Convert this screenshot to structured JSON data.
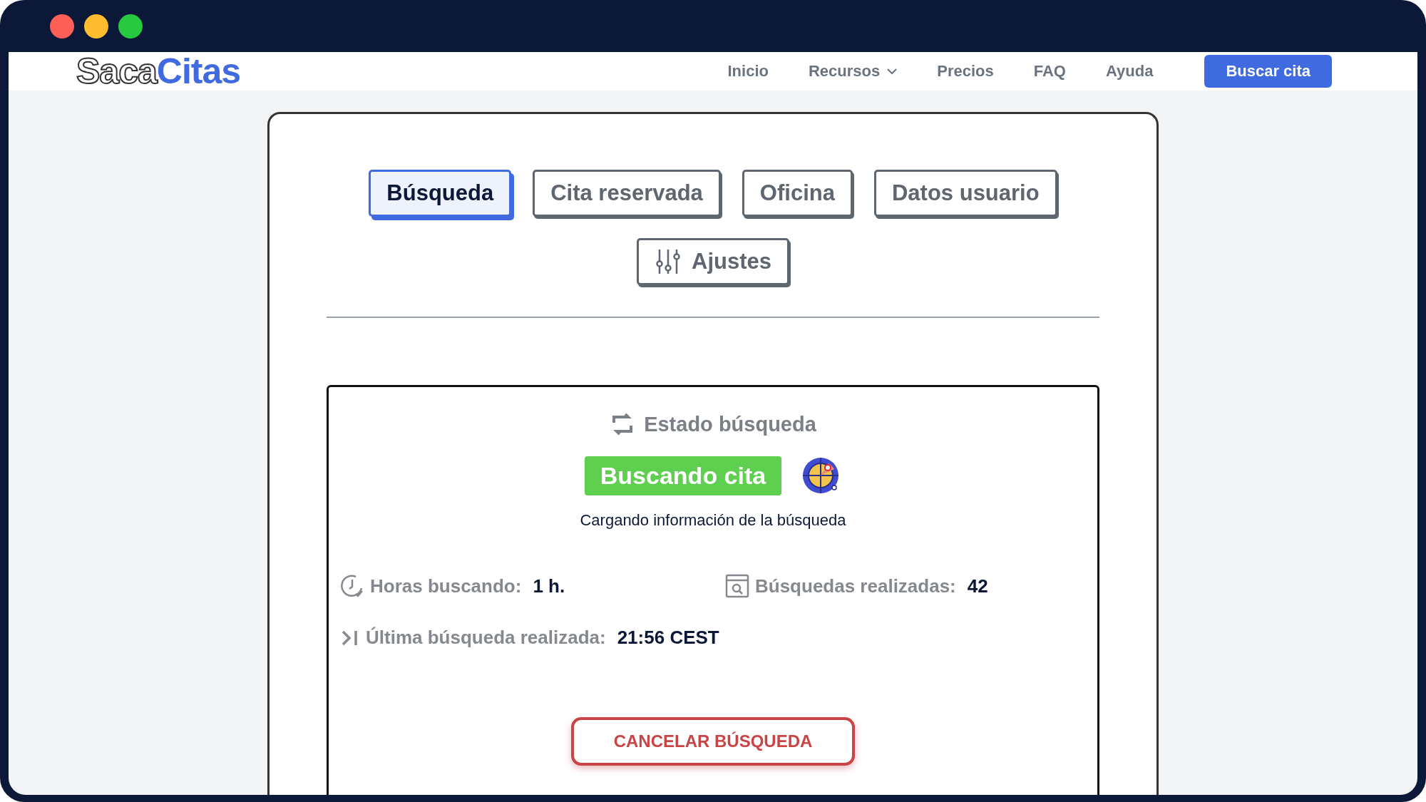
{
  "window": {
    "controls": [
      {
        "kind": "close"
      },
      {
        "kind": "minimize"
      },
      {
        "kind": "maximize"
      }
    ]
  },
  "header": {
    "logo": {
      "part_1": "Saca",
      "part_2": "Citas"
    },
    "nav": [
      {
        "label": "Inicio",
        "dropdown": false
      },
      {
        "label": "Recursos",
        "dropdown": true
      },
      {
        "label": "Precios",
        "dropdown": false
      },
      {
        "label": "FAQ",
        "dropdown": false
      },
      {
        "label": "Ayuda",
        "dropdown": false
      }
    ],
    "cta": "Buscar cita"
  },
  "tabs": [
    {
      "label": "Búsqueda",
      "selected": true,
      "icon": false
    },
    {
      "label": "Cita reservada",
      "selected": false,
      "icon": false
    },
    {
      "label": "Oficina",
      "selected": false,
      "icon": false
    },
    {
      "label": "Datos usuario",
      "selected": false,
      "icon": false
    },
    {
      "label": "Ajustes",
      "selected": false,
      "icon": true
    }
  ],
  "status": {
    "title": "Estado búsqueda",
    "badge": "Buscando cita",
    "message": "Cargando información de la búsqueda",
    "stats": [
      {
        "kind": "clock",
        "label": "Horas buscando:",
        "value": "1 h."
      },
      {
        "kind": "browser",
        "label": "Búsquedas realizadas:",
        "value": "42"
      },
      {
        "kind": "last",
        "label": "Última búsqueda realizada:",
        "value": "21:56 CEST"
      }
    ],
    "cancel": "CANCELAR BÚSQUEDA"
  }
}
